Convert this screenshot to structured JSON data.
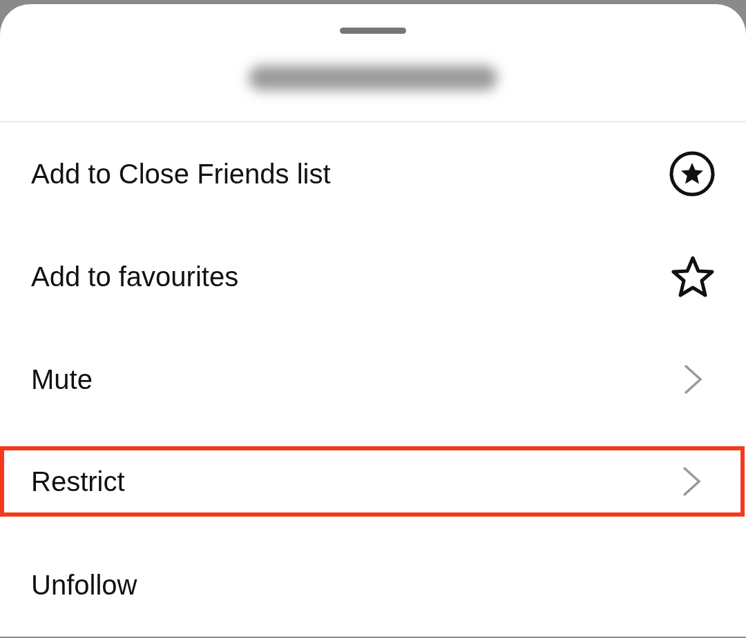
{
  "sheet": {
    "title_blurred": true
  },
  "items": [
    {
      "label": "Add to Close Friends list",
      "kind": "badge",
      "highlighted": false
    },
    {
      "label": "Add to favourites",
      "kind": "favourite",
      "highlighted": false
    },
    {
      "label": "Mute",
      "kind": "submenu",
      "highlighted": false
    },
    {
      "label": "Restrict",
      "kind": "submenu",
      "highlighted": true
    },
    {
      "label": "Unfollow",
      "highlighted": false
    }
  ]
}
